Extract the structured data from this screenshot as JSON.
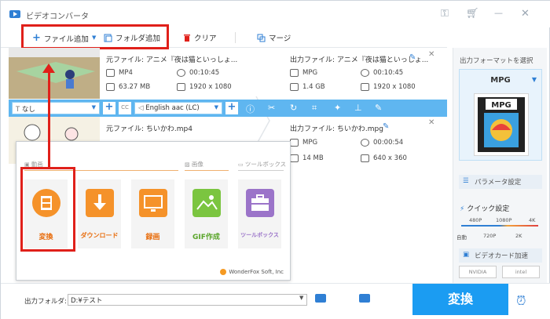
{
  "app": {
    "title": "ビデオコンバータ"
  },
  "toolbar": {
    "add_file": "ファイル追加",
    "add_folder": "フォルダ追加",
    "clear": "クリア",
    "merge": "マージ"
  },
  "items": [
    {
      "source": "元ファイル: アニメ『夜は猫といっしょ...",
      "output": "出力ファイル: アニメ『夜は猫といっしょ...",
      "src_format": "MP4",
      "src_duration": "00:10:45",
      "src_size": "63.27 MB",
      "src_res": "1920 x 1080",
      "out_format": "MPG",
      "out_duration": "00:10:45",
      "out_size": "1.4 GB",
      "out_res": "1920 x 1080"
    },
    {
      "source": "元ファイル: ちいかわ.mp4",
      "output": "出力ファイル: ちいかわ.mpg",
      "out_format": "MPG",
      "out_duration": "00:00:54",
      "out_size": "14 MB",
      "out_res": "640 x 360"
    }
  ],
  "item_bar": {
    "subtitle": "なし",
    "audio": "English aac (LC)"
  },
  "popup": {
    "cat_video": "動画",
    "cat_image": "画像",
    "cat_toolbox": "ツールボックス",
    "tools": [
      "変換",
      "ダウンロード",
      "録画",
      "GIF作成",
      "ツールボックス"
    ],
    "brand": "WonderFox Soft, Inc"
  },
  "right_panel": {
    "select_label": "出力フォーマットを選択",
    "format": "MPG",
    "param": "パラメータ設定",
    "quick": "クイック設定",
    "q_top": [
      "480P",
      "1080P",
      "4K"
    ],
    "q_bottom": [
      "自動",
      "720P",
      "2K"
    ],
    "gpu": "ビデオカード加速",
    "nvidia": "NVIDIA",
    "intel": "intel"
  },
  "bottom": {
    "out_label": "出力フォルダ:",
    "out_path": "D:¥テスト",
    "convert": "変換"
  },
  "colors": {
    "accent": "#1b9cf2",
    "bar": "#5fb6f0",
    "highlight": "#e0201a"
  }
}
